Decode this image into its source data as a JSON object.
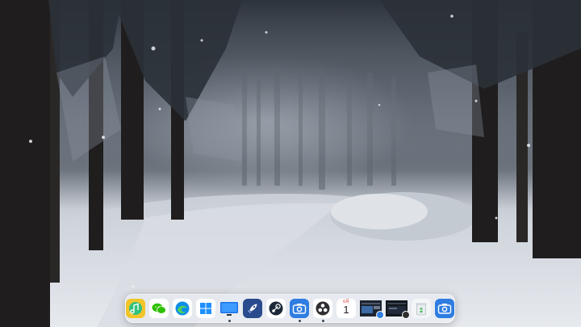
{
  "desktop": {
    "wallpaper": "snowy-forest-path-at-dusk"
  },
  "dock": {
    "items": [
      {
        "name": "qq-music",
        "icon": "music-note-icon",
        "color": "#31c27c",
        "running": false
      },
      {
        "name": "wechat",
        "icon": "wechat-icon",
        "color": "#2dc100",
        "running": false
      },
      {
        "name": "microsoft-edge",
        "icon": "edge-icon",
        "color": "#0f8ee8",
        "running": false
      },
      {
        "name": "windows-start",
        "icon": "windows-logo-icon",
        "color": "#1e90ff",
        "running": false
      },
      {
        "name": "desktop",
        "icon": "monitor-icon",
        "color": "#1a73e8",
        "running": true
      },
      {
        "name": "launcher",
        "icon": "rocket-icon",
        "color": "#2a4b8d",
        "running": false
      },
      {
        "name": "steam",
        "icon": "steam-icon",
        "color": "#1b2838",
        "running": false
      },
      {
        "name": "screenshot-tool",
        "icon": "camera-icon",
        "color": "#2f7de1",
        "running": true
      },
      {
        "name": "obs-studio",
        "icon": "obs-icon",
        "color": "#302e31",
        "running": true
      },
      {
        "name": "calendar",
        "icon": "calendar-icon",
        "month": "6月",
        "day": "1",
        "running": false
      },
      {
        "name": "window-preview-1",
        "icon": "window-thumbnail-icon",
        "running": false
      },
      {
        "name": "window-preview-2",
        "icon": "window-thumbnail-icon",
        "running": false
      },
      {
        "name": "recycle-bin",
        "icon": "recycle-bin-icon",
        "color": "#3bb54a",
        "running": false
      },
      {
        "name": "screen-capture",
        "icon": "camera-icon",
        "color": "#2f7de1",
        "running": false
      }
    ]
  }
}
